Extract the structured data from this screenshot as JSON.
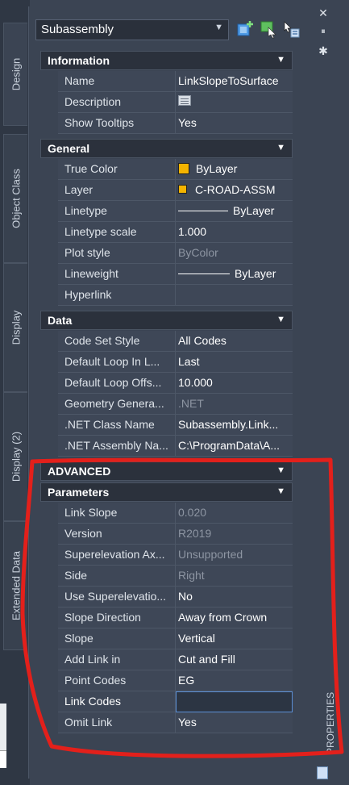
{
  "left_tabs": [
    "Design",
    "Object Class",
    "Display",
    "Display (2)",
    "Extended Data"
  ],
  "selector": {
    "value": "Subassembly"
  },
  "right_strip": {
    "close_glyph": "✕",
    "pin_glyph": "⏸",
    "settings_glyph": "✱",
    "palette_label": "PROPERTIES"
  },
  "sections": {
    "information": "Information",
    "general": "General",
    "data": "Data",
    "advanced": "ADVANCED",
    "parameters": "Parameters"
  },
  "information_rows": [
    {
      "name": "Name",
      "value": "LinkSlopeToSurface"
    },
    {
      "name": "Description",
      "value": ""
    },
    {
      "name": "Show Tooltips",
      "value": "Yes"
    }
  ],
  "general_rows": [
    {
      "name": "True Color",
      "value": "ByLayer"
    },
    {
      "name": "Layer",
      "value": "C-ROAD-ASSM"
    },
    {
      "name": "Linetype",
      "value": "ByLayer"
    },
    {
      "name": "Linetype scale",
      "value": "1.000"
    },
    {
      "name": "Plot style",
      "value": "ByColor"
    },
    {
      "name": "Lineweight",
      "value": "ByLayer"
    },
    {
      "name": "Hyperlink",
      "value": ""
    }
  ],
  "data_rows": [
    {
      "name": "Code Set Style",
      "value": "All Codes"
    },
    {
      "name": "Default Loop In L...",
      "value": "Last"
    },
    {
      "name": "Default Loop Offs...",
      "value": "10.000"
    },
    {
      "name": "Geometry Genera...",
      "value": ".NET"
    },
    {
      "name": ".NET Class Name",
      "value": "Subassembly.Link..."
    },
    {
      "name": ".NET Assembly Na...",
      "value": "C:\\ProgramData\\A..."
    }
  ],
  "parameter_rows": [
    {
      "name": "Link Slope",
      "value": "0.020"
    },
    {
      "name": "Version",
      "value": "R2019"
    },
    {
      "name": "Superelevation Ax...",
      "value": "Unsupported"
    },
    {
      "name": "Side",
      "value": "Right"
    },
    {
      "name": "Use Superelevatio...",
      "value": "No"
    },
    {
      "name": "Slope Direction",
      "value": "Away from Crown"
    },
    {
      "name": "Slope",
      "value": "Vertical"
    },
    {
      "name": "Add Link in",
      "value": "Cut and Fill"
    },
    {
      "name": "Point Codes",
      "value": "EG"
    },
    {
      "name": "Link Codes",
      "value": ""
    },
    {
      "name": "Omit Link",
      "value": "Yes"
    }
  ],
  "colors": {
    "swatch": "#f4b400",
    "annotation": "#e3201b",
    "edit_border": "#5b8fd6"
  }
}
